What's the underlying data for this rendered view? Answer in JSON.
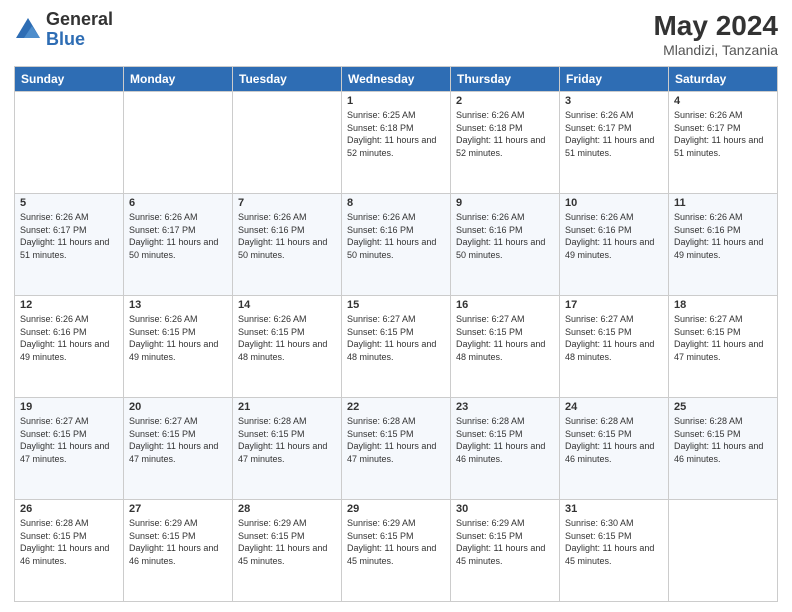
{
  "logo": {
    "general": "General",
    "blue": "Blue"
  },
  "header": {
    "month": "May 2024",
    "location": "Mlandizi, Tanzania"
  },
  "days_of_week": [
    "Sunday",
    "Monday",
    "Tuesday",
    "Wednesday",
    "Thursday",
    "Friday",
    "Saturday"
  ],
  "weeks": [
    [
      {
        "day": "",
        "sunrise": "",
        "sunset": "",
        "daylight": ""
      },
      {
        "day": "",
        "sunrise": "",
        "sunset": "",
        "daylight": ""
      },
      {
        "day": "",
        "sunrise": "",
        "sunset": "",
        "daylight": ""
      },
      {
        "day": "1",
        "sunrise": "Sunrise: 6:25 AM",
        "sunset": "Sunset: 6:18 PM",
        "daylight": "Daylight: 11 hours and 52 minutes."
      },
      {
        "day": "2",
        "sunrise": "Sunrise: 6:26 AM",
        "sunset": "Sunset: 6:18 PM",
        "daylight": "Daylight: 11 hours and 52 minutes."
      },
      {
        "day": "3",
        "sunrise": "Sunrise: 6:26 AM",
        "sunset": "Sunset: 6:17 PM",
        "daylight": "Daylight: 11 hours and 51 minutes."
      },
      {
        "day": "4",
        "sunrise": "Sunrise: 6:26 AM",
        "sunset": "Sunset: 6:17 PM",
        "daylight": "Daylight: 11 hours and 51 minutes."
      }
    ],
    [
      {
        "day": "5",
        "sunrise": "Sunrise: 6:26 AM",
        "sunset": "Sunset: 6:17 PM",
        "daylight": "Daylight: 11 hours and 51 minutes."
      },
      {
        "day": "6",
        "sunrise": "Sunrise: 6:26 AM",
        "sunset": "Sunset: 6:17 PM",
        "daylight": "Daylight: 11 hours and 50 minutes."
      },
      {
        "day": "7",
        "sunrise": "Sunrise: 6:26 AM",
        "sunset": "Sunset: 6:16 PM",
        "daylight": "Daylight: 11 hours and 50 minutes."
      },
      {
        "day": "8",
        "sunrise": "Sunrise: 6:26 AM",
        "sunset": "Sunset: 6:16 PM",
        "daylight": "Daylight: 11 hours and 50 minutes."
      },
      {
        "day": "9",
        "sunrise": "Sunrise: 6:26 AM",
        "sunset": "Sunset: 6:16 PM",
        "daylight": "Daylight: 11 hours and 50 minutes."
      },
      {
        "day": "10",
        "sunrise": "Sunrise: 6:26 AM",
        "sunset": "Sunset: 6:16 PM",
        "daylight": "Daylight: 11 hours and 49 minutes."
      },
      {
        "day": "11",
        "sunrise": "Sunrise: 6:26 AM",
        "sunset": "Sunset: 6:16 PM",
        "daylight": "Daylight: 11 hours and 49 minutes."
      }
    ],
    [
      {
        "day": "12",
        "sunrise": "Sunrise: 6:26 AM",
        "sunset": "Sunset: 6:16 PM",
        "daylight": "Daylight: 11 hours and 49 minutes."
      },
      {
        "day": "13",
        "sunrise": "Sunrise: 6:26 AM",
        "sunset": "Sunset: 6:15 PM",
        "daylight": "Daylight: 11 hours and 49 minutes."
      },
      {
        "day": "14",
        "sunrise": "Sunrise: 6:26 AM",
        "sunset": "Sunset: 6:15 PM",
        "daylight": "Daylight: 11 hours and 48 minutes."
      },
      {
        "day": "15",
        "sunrise": "Sunrise: 6:27 AM",
        "sunset": "Sunset: 6:15 PM",
        "daylight": "Daylight: 11 hours and 48 minutes."
      },
      {
        "day": "16",
        "sunrise": "Sunrise: 6:27 AM",
        "sunset": "Sunset: 6:15 PM",
        "daylight": "Daylight: 11 hours and 48 minutes."
      },
      {
        "day": "17",
        "sunrise": "Sunrise: 6:27 AM",
        "sunset": "Sunset: 6:15 PM",
        "daylight": "Daylight: 11 hours and 48 minutes."
      },
      {
        "day": "18",
        "sunrise": "Sunrise: 6:27 AM",
        "sunset": "Sunset: 6:15 PM",
        "daylight": "Daylight: 11 hours and 47 minutes."
      }
    ],
    [
      {
        "day": "19",
        "sunrise": "Sunrise: 6:27 AM",
        "sunset": "Sunset: 6:15 PM",
        "daylight": "Daylight: 11 hours and 47 minutes."
      },
      {
        "day": "20",
        "sunrise": "Sunrise: 6:27 AM",
        "sunset": "Sunset: 6:15 PM",
        "daylight": "Daylight: 11 hours and 47 minutes."
      },
      {
        "day": "21",
        "sunrise": "Sunrise: 6:28 AM",
        "sunset": "Sunset: 6:15 PM",
        "daylight": "Daylight: 11 hours and 47 minutes."
      },
      {
        "day": "22",
        "sunrise": "Sunrise: 6:28 AM",
        "sunset": "Sunset: 6:15 PM",
        "daylight": "Daylight: 11 hours and 47 minutes."
      },
      {
        "day": "23",
        "sunrise": "Sunrise: 6:28 AM",
        "sunset": "Sunset: 6:15 PM",
        "daylight": "Daylight: 11 hours and 46 minutes."
      },
      {
        "day": "24",
        "sunrise": "Sunrise: 6:28 AM",
        "sunset": "Sunset: 6:15 PM",
        "daylight": "Daylight: 11 hours and 46 minutes."
      },
      {
        "day": "25",
        "sunrise": "Sunrise: 6:28 AM",
        "sunset": "Sunset: 6:15 PM",
        "daylight": "Daylight: 11 hours and 46 minutes."
      }
    ],
    [
      {
        "day": "26",
        "sunrise": "Sunrise: 6:28 AM",
        "sunset": "Sunset: 6:15 PM",
        "daylight": "Daylight: 11 hours and 46 minutes."
      },
      {
        "day": "27",
        "sunrise": "Sunrise: 6:29 AM",
        "sunset": "Sunset: 6:15 PM",
        "daylight": "Daylight: 11 hours and 46 minutes."
      },
      {
        "day": "28",
        "sunrise": "Sunrise: 6:29 AM",
        "sunset": "Sunset: 6:15 PM",
        "daylight": "Daylight: 11 hours and 45 minutes."
      },
      {
        "day": "29",
        "sunrise": "Sunrise: 6:29 AM",
        "sunset": "Sunset: 6:15 PM",
        "daylight": "Daylight: 11 hours and 45 minutes."
      },
      {
        "day": "30",
        "sunrise": "Sunrise: 6:29 AM",
        "sunset": "Sunset: 6:15 PM",
        "daylight": "Daylight: 11 hours and 45 minutes."
      },
      {
        "day": "31",
        "sunrise": "Sunrise: 6:30 AM",
        "sunset": "Sunset: 6:15 PM",
        "daylight": "Daylight: 11 hours and 45 minutes."
      },
      {
        "day": "",
        "sunrise": "",
        "sunset": "",
        "daylight": ""
      }
    ]
  ]
}
